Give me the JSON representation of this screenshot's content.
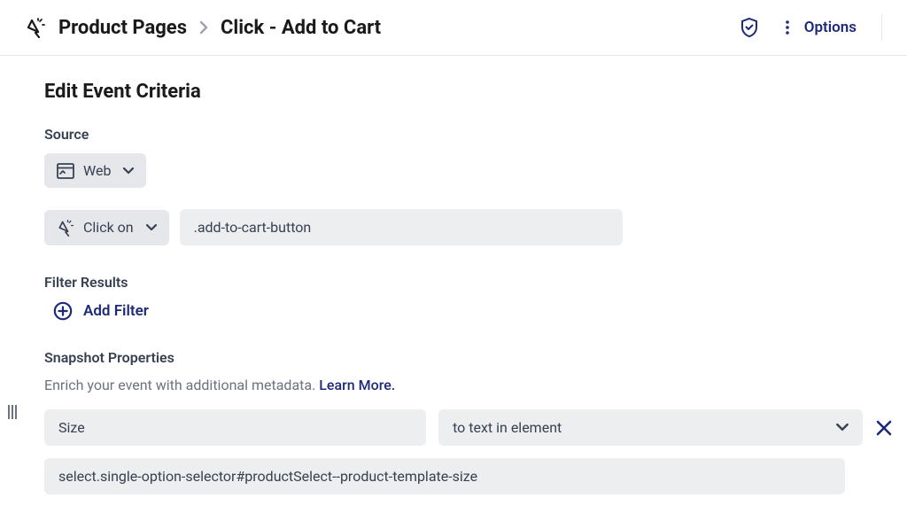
{
  "header": {
    "breadcrumb_parent": "Product Pages",
    "breadcrumb_current": "Click - Add to Cart",
    "options_label": "Options"
  },
  "editor": {
    "title": "Edit Event Criteria",
    "source_label": "Source",
    "source_value": "Web",
    "action_value": "Click on",
    "selector_value": ".add-to-cart-button",
    "filter_label": "Filter Results",
    "add_filter_label": "Add Filter",
    "snapshot_label": "Snapshot Properties",
    "snapshot_desc": "Enrich your event with additional metadata.",
    "learn_more": "Learn More.",
    "property": {
      "name": "Size",
      "type": "to text in element",
      "selector": "select.single-option-selector#productSelect--product-template-size"
    }
  }
}
